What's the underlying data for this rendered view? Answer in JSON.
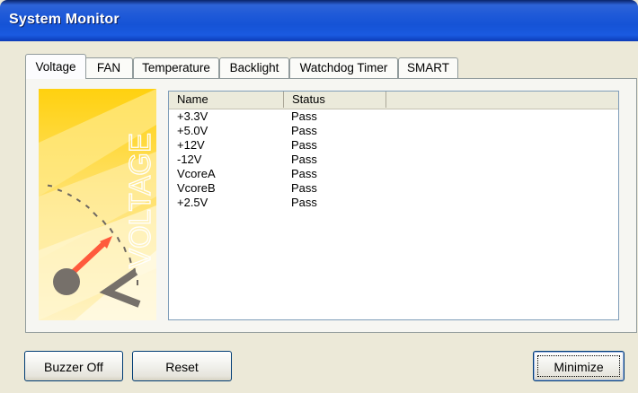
{
  "window": {
    "title": "System Monitor"
  },
  "tabs": [
    {
      "label": "Voltage",
      "active": true
    },
    {
      "label": "FAN"
    },
    {
      "label": "Temperature"
    },
    {
      "label": "Backlight"
    },
    {
      "label": "Watchdog Timer"
    },
    {
      "label": "SMART"
    }
  ],
  "banner": {
    "label": "VOLTAGE",
    "icon": "voltage-gauge-icon"
  },
  "list": {
    "columns": [
      "Name",
      "Status",
      ""
    ],
    "rows": [
      {
        "name": "+3.3V",
        "status": "Pass"
      },
      {
        "name": "+5.0V",
        "status": "Pass"
      },
      {
        "name": "+12V",
        "status": "Pass"
      },
      {
        "name": "-12V",
        "status": "Pass"
      },
      {
        "name": "VcoreA",
        "status": "Pass"
      },
      {
        "name": "VcoreB",
        "status": "Pass"
      },
      {
        "name": "+2.5V",
        "status": "Pass"
      }
    ]
  },
  "buttons": {
    "buzzer_off": "Buzzer Off",
    "reset": "Reset",
    "minimize": "Minimize"
  },
  "colors": {
    "titlebar": "#1553d6",
    "banner_yellow": "#ffd21e",
    "gauge_needle": "#ff5a3c",
    "gauge_hub": "#76706a"
  }
}
